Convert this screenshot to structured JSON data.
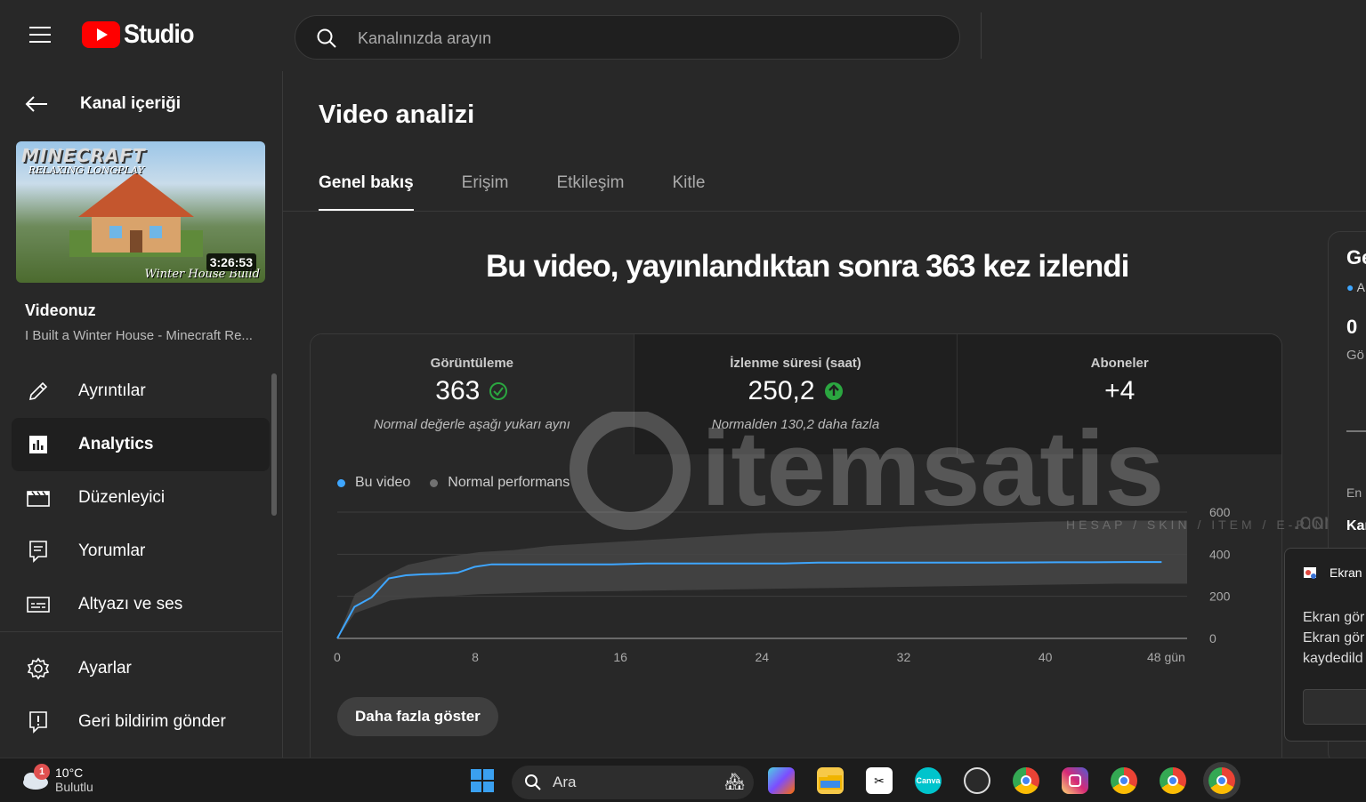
{
  "header": {
    "app_name": "Studio",
    "search_placeholder": "Kanalınızda arayın"
  },
  "sidebar": {
    "back_label": "Kanal içeriği",
    "thumbnail": {
      "title_art": "MINECRAFT",
      "subtitle_art": "RELAXING LONGPLAY",
      "caption_art": "Winter House Build",
      "duration": "3:26:53"
    },
    "your_video_label": "Videonuz",
    "video_title": "I Built a Winter House - Minecraft Re...",
    "items": [
      {
        "label": "Ayrıntılar",
        "icon": "pencil-icon"
      },
      {
        "label": "Analytics",
        "icon": "analytics-icon",
        "active": true
      },
      {
        "label": "Düzenleyici",
        "icon": "clapperboard-icon"
      },
      {
        "label": "Yorumlar",
        "icon": "comment-icon"
      },
      {
        "label": "Altyazı ve ses",
        "icon": "subtitles-icon"
      }
    ],
    "bottom_items": [
      {
        "label": "Ayarlar",
        "icon": "gear-icon"
      },
      {
        "label": "Geri bildirim gönder",
        "icon": "feedback-icon"
      }
    ]
  },
  "main": {
    "page_title": "Video analizi",
    "tabs": [
      {
        "label": "Genel bakış",
        "active": true
      },
      {
        "label": "Erişim"
      },
      {
        "label": "Etkileşim"
      },
      {
        "label": "Kitle"
      }
    ],
    "headline": "Bu video, yayınlandıktan sonra 363 kez izlendi",
    "metrics": [
      {
        "label": "Görüntüleme",
        "value": "363",
        "status_icon": "check-circle-icon",
        "note": "Normal değerle aşağı yukarı aynı"
      },
      {
        "label": "İzlenme süresi (saat)",
        "value": "250,2",
        "status_icon": "arrow-up-circle-icon",
        "note": "Normalden 130,2 daha fazla"
      },
      {
        "label": "Aboneler",
        "value": "+4",
        "note": ""
      }
    ],
    "legend": [
      {
        "label": "Bu video",
        "color": "#3ea6ff"
      },
      {
        "label": "Normal performans",
        "color": "#717171"
      }
    ],
    "more_button": "Daha fazla göster"
  },
  "chart_data": {
    "type": "line",
    "x_ticks": [
      "0",
      "8",
      "16",
      "24",
      "32",
      "40",
      "48 gün"
    ],
    "y_ticks": [
      "600",
      "400",
      "200",
      "0"
    ],
    "xlim": [
      0,
      48
    ],
    "ylim": [
      0,
      600
    ],
    "series": [
      {
        "name": "Bu video",
        "color": "#3ea6ff",
        "x": [
          0,
          1,
          2,
          3,
          4,
          5,
          6,
          7,
          8,
          9,
          10,
          12,
          14,
          16,
          18,
          20,
          22,
          24,
          26,
          28,
          30,
          32,
          34,
          36,
          38,
          40,
          42,
          44,
          46,
          48
        ],
        "y": [
          0,
          150,
          195,
          285,
          300,
          305,
          307,
          312,
          340,
          352,
          352,
          352,
          352,
          352,
          356,
          356,
          356,
          356,
          356,
          360,
          360,
          360,
          360,
          360,
          360,
          361,
          362,
          362,
          363,
          363
        ]
      },
      {
        "name": "Normal performans",
        "type": "band",
        "color": "#454545",
        "x": [
          0,
          1,
          2,
          3,
          4,
          6,
          8,
          10,
          12,
          16,
          20,
          24,
          28,
          32,
          36,
          40,
          44,
          48
        ],
        "upper": [
          0,
          210,
          260,
          310,
          350,
          385,
          410,
          420,
          440,
          460,
          480,
          500,
          510,
          530,
          545,
          555,
          560,
          560
        ],
        "lower": [
          0,
          120,
          150,
          180,
          190,
          200,
          210,
          215,
          220,
          225,
          230,
          235,
          240,
          245,
          250,
          255,
          260,
          260
        ]
      }
    ]
  },
  "side_card": {
    "title": "Ge",
    "subtitle": "A",
    "value": "0",
    "label": "Gö",
    "footer_small": "En",
    "footer_bold": "Kar"
  },
  "toast": {
    "title": "Ekran",
    "line1": "Ekran gör",
    "line2": "Ekran gör",
    "line3": "kaydedild"
  },
  "taskbar": {
    "weather_badge": "1",
    "temperature": "10°C",
    "condition": "Bulutlu",
    "search_label": "Ara"
  },
  "watermark": {
    "brand": "itemsatis",
    "tagline": "HESAP / SKIN / ITEM / E-PIN",
    "domain": ".com"
  }
}
